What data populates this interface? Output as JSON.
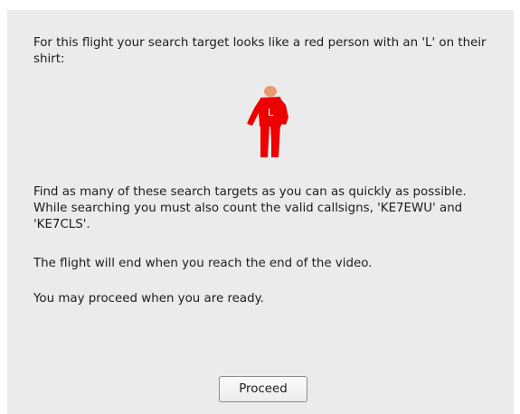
{
  "instructions": {
    "intro": "For this flight your search target looks like a red person with an 'L' on their shirt:",
    "target_shirt_letter": "L",
    "paragraph_find": "Find as many of these search targets as you can as quickly as possible. While searching you must also count the valid callsigns, 'KE7EWU' and 'KE7CLS'.",
    "paragraph_end": "The flight will end when you reach the end of the video.",
    "paragraph_proceed": "You may proceed when you are ready."
  },
  "buttons": {
    "proceed_label": "Proceed"
  },
  "colors": {
    "target_body": "#ee0000",
    "target_head": "#e79a6f",
    "panel_background": "#ebebeb"
  },
  "icons": {
    "target": "red-person-target-icon"
  }
}
